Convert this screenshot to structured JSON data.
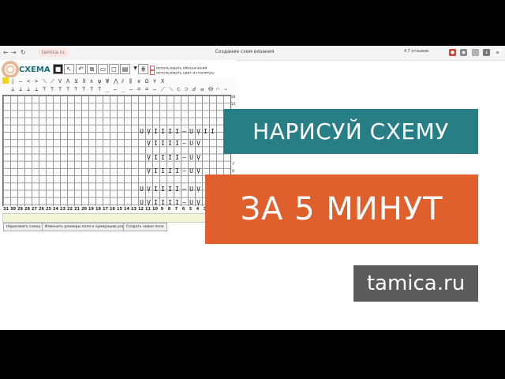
{
  "browser": {
    "back": "←",
    "forward": "→",
    "reload": "↻",
    "url": "tamica.ru",
    "tab_title": "Создание схем вязания",
    "reviews": "4.7 отзывов"
  },
  "app": {
    "title": "СХЕМА",
    "option_1": "использовать обозначения",
    "option_2": "использовать цвет из палитры",
    "tools": [
      "■",
      "↖",
      "↶",
      "⧉",
      "▭",
      "◻",
      "▤",
      "▼",
      "⋕"
    ]
  },
  "palette": {
    "row1": [
      "|",
      "—",
      "<",
      ">",
      "⟍",
      "⟋",
      "V",
      "Λ",
      "⊻",
      "⊼",
      "∧",
      "ψ",
      "Ψ",
      "⋀",
      "⫽",
      "⫼",
      "∨",
      "Ω",
      "⋎",
      "X"
    ],
    "row2": [
      "⊥",
      "⊥",
      "⊥",
      "⊥",
      "⊤",
      "⊤",
      "⊤",
      "⊤",
      "⊤",
      "⊤",
      "⊤",
      "⊤",
      "_",
      "—",
      "_",
      "—",
      "=",
      "=",
      "—",
      "⟋",
      "⟍",
      "⊂",
      "⊃",
      "Ꮷ",
      "ⴰ",
      "ⴱ",
      "⌒",
      "⌣"
    ],
    "color": "#f7d516"
  },
  "grid": {
    "row_numbers": [
      "16",
      "15",
      "",
      "",
      "",
      "",
      "",
      "",
      "9",
      "",
      "7",
      "6",
      "5",
      "",
      "3",
      "",
      "1"
    ],
    "col_numbers": [
      "31",
      "30",
      "29",
      "28",
      "27",
      "26",
      "25",
      "24",
      "23",
      "22",
      "21",
      "20",
      "19",
      "18",
      "17",
      "16",
      "15",
      "14",
      "13",
      "12",
      "11",
      "10",
      "9",
      "8",
      "7",
      "6",
      "5",
      "4",
      "3",
      "2",
      "1"
    ],
    "pattern_rows": [
      [
        "U",
        "Ṿ",
        "I",
        "I",
        "I",
        "I",
        "—",
        "U",
        "Ṿ",
        "I",
        "I"
      ],
      [
        "",
        "Ṿ",
        "I",
        "I",
        "I",
        "I",
        "—",
        "U",
        "Ṿ",
        "",
        ""
      ],
      [
        "",
        "Ṿ",
        "I",
        "I",
        "I",
        "I",
        "—",
        "U",
        "Ṿ",
        "",
        ""
      ],
      [
        "",
        "Ṿ",
        "I",
        "I",
        "I",
        "I",
        "—",
        "U",
        "Ṿ",
        "",
        ""
      ],
      [
        "U",
        "Ṿ",
        "I",
        "I",
        "I",
        "I",
        "—",
        "U",
        "Ṿ",
        "",
        ""
      ],
      [
        "U",
        "Ṿ",
        "I",
        "I",
        "I",
        "I",
        "—",
        "U",
        "Ṿ",
        "",
        ""
      ]
    ]
  },
  "buttons": {
    "draw": "Нарисовать схему",
    "resize": "Изменить размеры поля и нумерацию рядов",
    "new_field": "Создать новое поле"
  },
  "banners": {
    "line1": "НАРИСУЙ СХЕМУ",
    "line2": "ЗА 5 МИНУТ",
    "site": "tamica.ru"
  },
  "colors": {
    "teal": "#287e85",
    "orange": "#e0602d",
    "gray": "#5b5b5b"
  }
}
